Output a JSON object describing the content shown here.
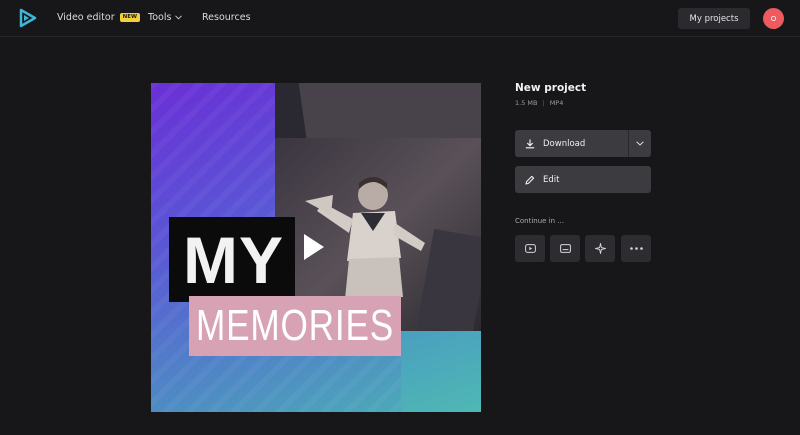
{
  "header": {
    "nav": {
      "video_editor": "Video editor",
      "new_badge": "NEW",
      "tools": "Tools",
      "resources": "Resources"
    },
    "my_projects": "My projects",
    "avatar_initial": "O"
  },
  "preview": {
    "title_line1": "MY",
    "title_line2": "MEMORIES"
  },
  "project": {
    "name": "New project",
    "size": "1.5 MB",
    "separator": "|",
    "format": "MP4"
  },
  "actions": {
    "download": "Download",
    "edit": "Edit"
  },
  "continue": {
    "label": "Continue in ...",
    "icons": [
      "youtube-icon",
      "subtitles-icon",
      "sparkle-icon",
      "more-icon"
    ]
  },
  "colors": {
    "background": "#171719",
    "button": "#3b3b40",
    "badge": "#f3d13a",
    "avatar": "#ee5a5e",
    "logo": "#3fb6d6"
  }
}
